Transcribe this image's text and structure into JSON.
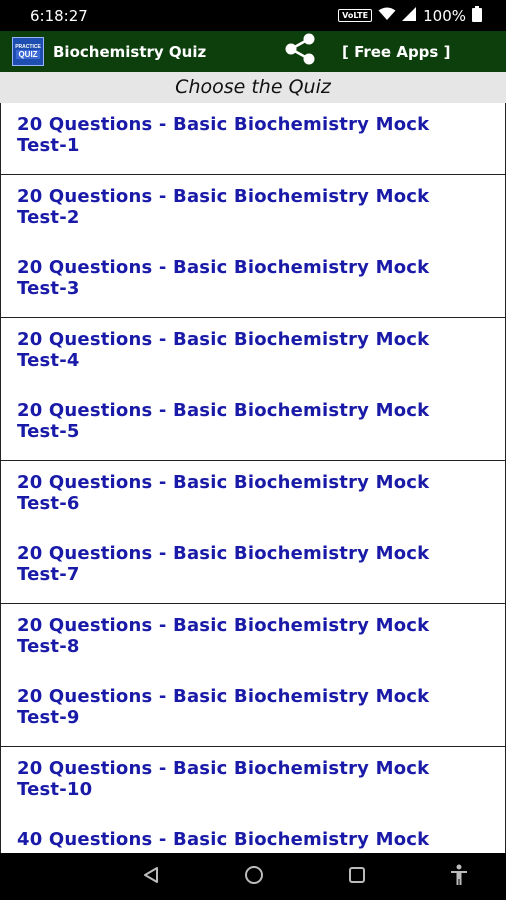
{
  "status_bar": {
    "time": "6:18:27",
    "network_badge": "VoLTE",
    "battery": "100%"
  },
  "app_bar": {
    "logo_top": "PRACTICE",
    "logo_main": "QUIZ",
    "title": "Biochemistry Quiz",
    "free_apps": "[ Free Apps ]"
  },
  "header": {
    "title": "Choose the Quiz"
  },
  "quizzes": [
    {
      "line1": "20 Questions - Basic Biochemistry Mock",
      "line2": "Test-1"
    },
    {
      "line1": "20 Questions - Basic Biochemistry Mock",
      "line2": "Test-2"
    },
    {
      "line1": "20 Questions - Basic Biochemistry Mock",
      "line2": "Test-3"
    },
    {
      "line1": "20 Questions - Basic Biochemistry Mock",
      "line2": "Test-4"
    },
    {
      "line1": "20 Questions - Basic Biochemistry Mock",
      "line2": "Test-5"
    },
    {
      "line1": "20 Questions - Basic Biochemistry Mock",
      "line2": "Test-6"
    },
    {
      "line1": "20 Questions - Basic Biochemistry Mock",
      "line2": "Test-7"
    },
    {
      "line1": "20 Questions - Basic Biochemistry Mock",
      "line2": "Test-8"
    },
    {
      "line1": "20 Questions - Basic Biochemistry Mock",
      "line2": "Test-9"
    },
    {
      "line1": "20 Questions - Basic Biochemistry Mock",
      "line2": "Test-10"
    },
    {
      "line1": "40 Questions - Basic Biochemistry Mock",
      "line2": ""
    }
  ],
  "colors": {
    "app_bar": "#0d3f0d",
    "quiz_text": "#1a1aa8",
    "header_strip": "#e6e6e6"
  },
  "icons": {
    "share": "share-icon",
    "back": "back-triangle-icon",
    "home": "home-circle-icon",
    "recents": "recents-square-icon",
    "accessibility": "accessibility-icon"
  }
}
